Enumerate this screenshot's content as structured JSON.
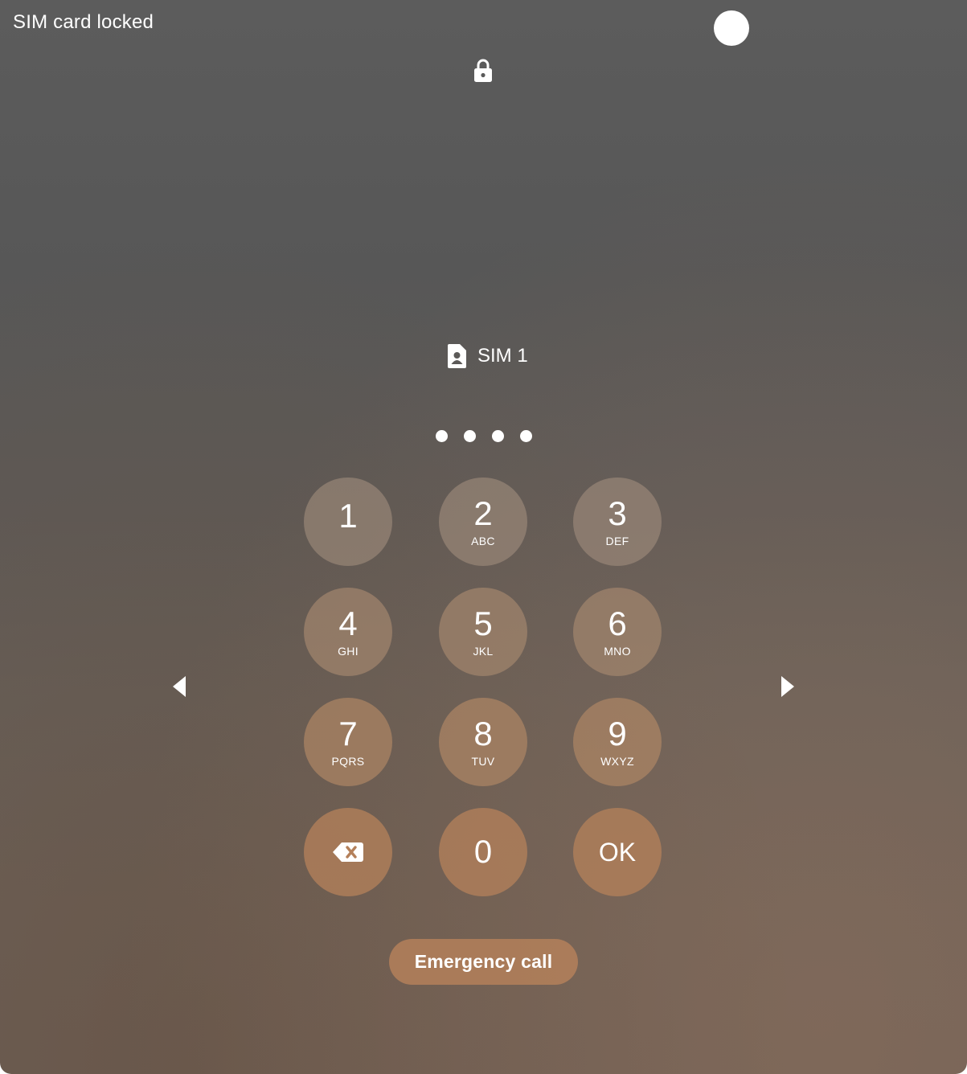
{
  "status_bar": {
    "title": "SIM card locked"
  },
  "icons": {
    "lock": "lock-icon",
    "sim": "sim-card-icon",
    "backspace": "backspace-icon",
    "arrow_left": "arrow-left-icon",
    "arrow_right": "arrow-right-icon"
  },
  "sim": {
    "label": "SIM 1"
  },
  "pin": {
    "entered_count": 4
  },
  "keypad": {
    "k1": {
      "digit": "1",
      "letters": ""
    },
    "k2": {
      "digit": "2",
      "letters": "ABC"
    },
    "k3": {
      "digit": "3",
      "letters": "DEF"
    },
    "k4": {
      "digit": "4",
      "letters": "GHI"
    },
    "k5": {
      "digit": "5",
      "letters": "JKL"
    },
    "k6": {
      "digit": "6",
      "letters": "MNO"
    },
    "k7": {
      "digit": "7",
      "letters": "PQRS"
    },
    "k8": {
      "digit": "8",
      "letters": "TUV"
    },
    "k9": {
      "digit": "9",
      "letters": "WXYZ"
    },
    "k0": {
      "digit": "0"
    },
    "ok": {
      "label": "OK"
    }
  },
  "emergency_call": {
    "label": "Emergency call"
  },
  "colors": {
    "text": "#ffffff",
    "key_accent": "#b4805a"
  }
}
